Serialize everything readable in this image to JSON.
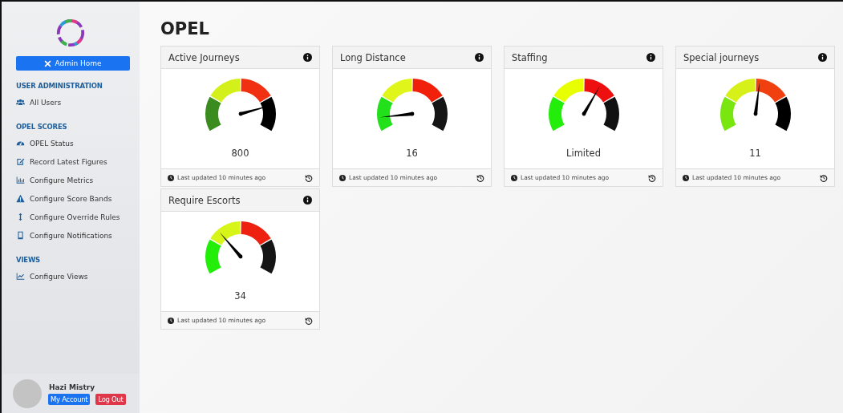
{
  "sidebar": {
    "admin_button": "Admin Home",
    "sections": [
      {
        "heading": "USER ADMINISTRATION",
        "items": [
          {
            "label": "All Users"
          }
        ]
      },
      {
        "heading": "OPEL SCORES",
        "items": [
          {
            "label": "OPEL Status"
          },
          {
            "label": "Record Latest Figures"
          },
          {
            "label": "Configure Metrics"
          },
          {
            "label": "Configure Score Bands"
          },
          {
            "label": "Configure Override Rules"
          },
          {
            "label": "Configure Notifications"
          }
        ]
      },
      {
        "heading": "VIEWS",
        "items": [
          {
            "label": "Configure Views"
          }
        ]
      }
    ],
    "user": {
      "name": "Hazi Mistry",
      "account_button": "My Account",
      "logout_button": "Log Out"
    }
  },
  "page_title": "OPEL",
  "cards": [
    {
      "title": "Active Journeys",
      "value": "800",
      "updated": "Last updated 10 minutes ago"
    },
    {
      "title": "Long Distance",
      "value": "16",
      "updated": "Last updated 10 minutes ago"
    },
    {
      "title": "Staffing",
      "value": "Limited",
      "updated": "Last updated 10 minutes ago"
    },
    {
      "title": "Special journeys",
      "value": "11",
      "updated": "Last updated 10 minutes ago"
    },
    {
      "title": "Require Escorts",
      "value": "34",
      "updated": "Last updated 10 minutes ago"
    }
  ]
}
